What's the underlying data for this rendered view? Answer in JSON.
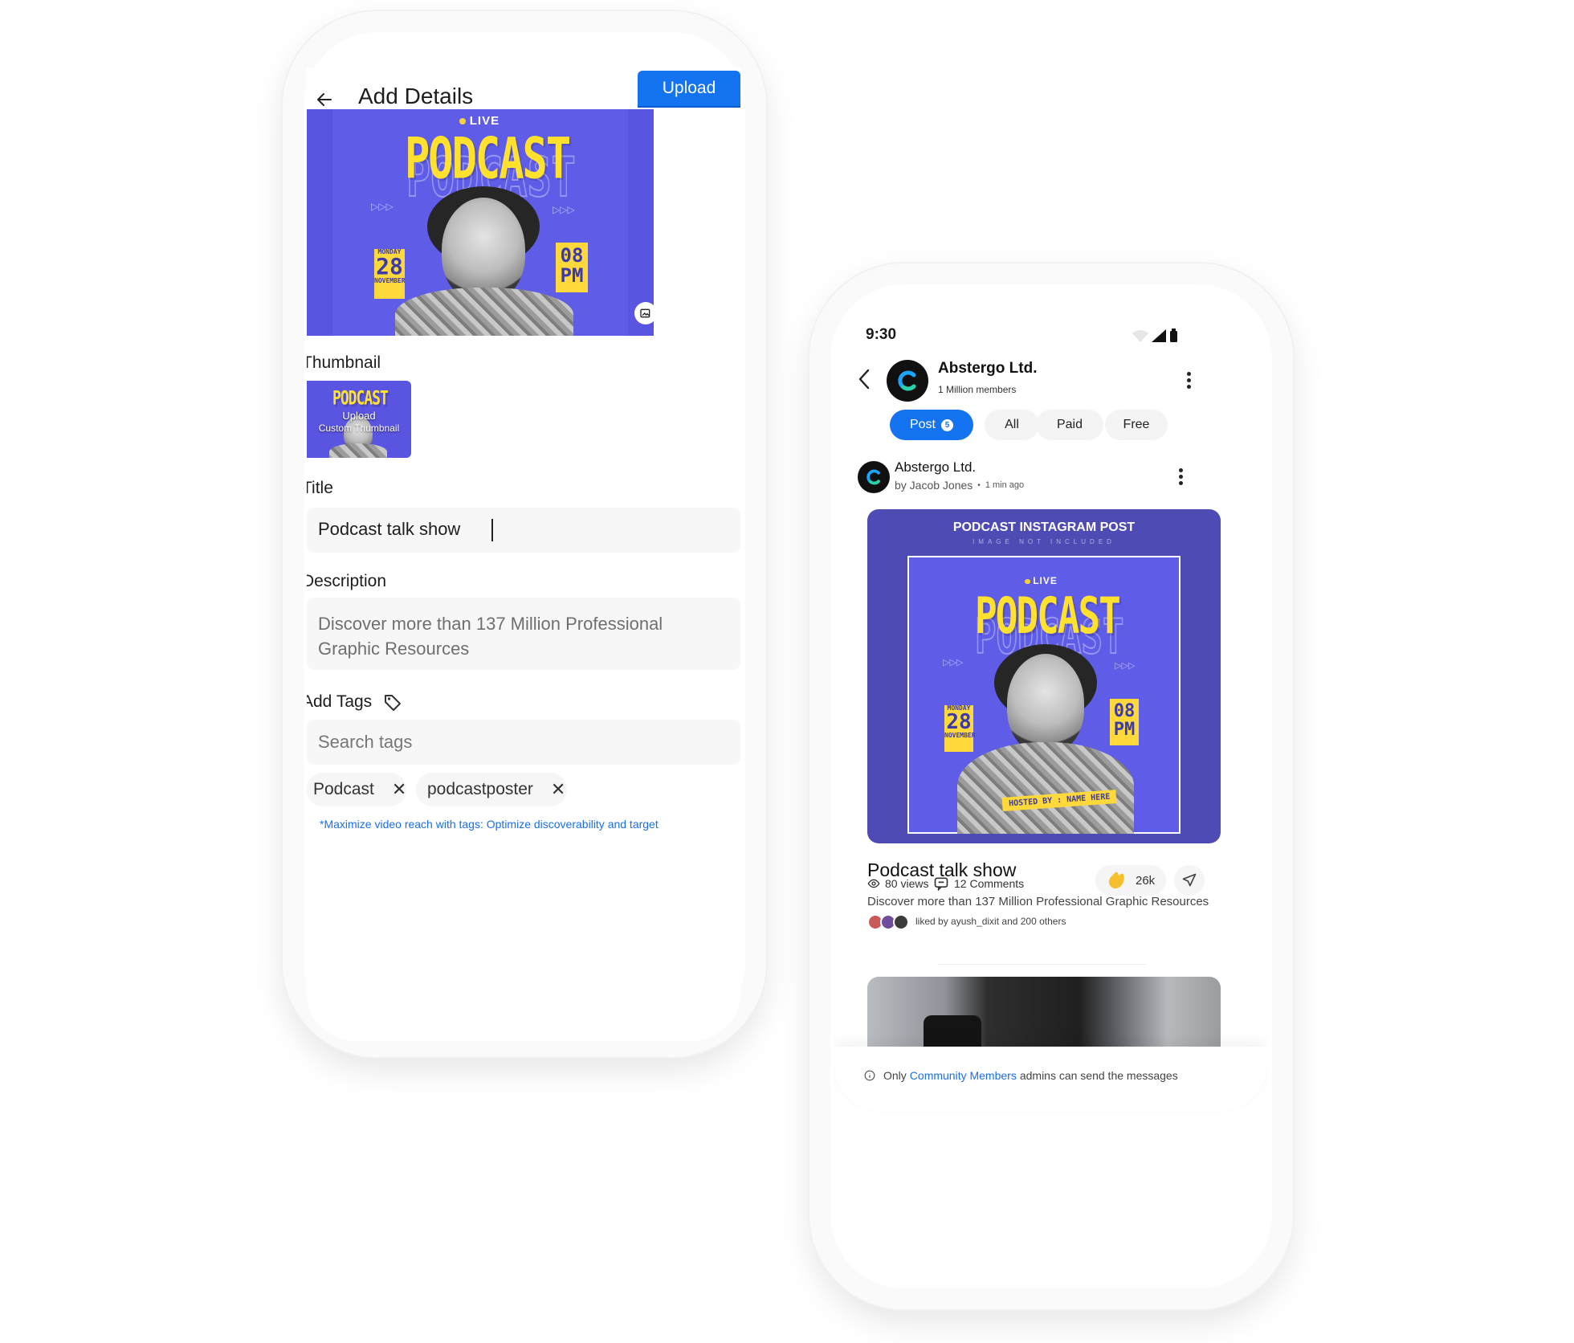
{
  "left": {
    "header": {
      "title": "Add Details",
      "upload_label": "Upload"
    },
    "poster": {
      "live": "LIVE",
      "title": "PODCAST",
      "day": "MONDAY",
      "date": "28",
      "month": "NOVEMBER",
      "time_top": "08",
      "time_unit": "PM"
    },
    "thumbnail": {
      "label": "Thumbnail",
      "upload_text": "Upload",
      "custom_text": "Custom Thumbnail",
      "poster_title": "PODCAST"
    },
    "title_field": {
      "label": "Title",
      "value": "Podcast talk show"
    },
    "description_field": {
      "label": "Description",
      "value": "Discover more than 137 Million Professional Graphic Resources"
    },
    "tags": {
      "label": "Add Tags",
      "search_placeholder": "Search tags",
      "chips": [
        "Podcast",
        "podcastposter"
      ]
    },
    "hint": "*Maximize video reach with tags: Optimize discoverability and target"
  },
  "right": {
    "status": {
      "time": "9:30"
    },
    "community": {
      "name": "Abstergo Ltd.",
      "members": "1 Million members"
    },
    "filters": [
      {
        "label": "Post",
        "badge": "5",
        "active": true
      },
      {
        "label": "All",
        "active": false
      },
      {
        "label": "Paid",
        "active": false
      },
      {
        "label": "Free",
        "active": false
      }
    ],
    "post": {
      "author": "Abstergo Ltd.",
      "by": "by Jacob Jones",
      "time": "1 min ago",
      "image_header": "PODCAST INSTAGRAM POST",
      "image_sub": "IMAGE NOT INCLUDED",
      "poster": {
        "live": "LIVE",
        "title": "PODCAST",
        "day": "MONDAY",
        "date": "28",
        "month": "NOVEMBER",
        "time_top": "08",
        "time_unit": "PM",
        "hosted": "HOSTED BY : NAME HERE"
      },
      "title": "Podcast talk show",
      "description": "Discover more than 137 Million Professional Graphic Resources",
      "views": "80 views",
      "comments": "12 Comments",
      "likes": "26k",
      "liked_by": "liked by ayush_dixit and 200 others"
    },
    "footer": {
      "prefix": "Only",
      "link": "Community Members",
      "suffix": "admins can send the messages"
    }
  },
  "colors": {
    "accent": "#1473f1",
    "poster_bg": "#5a55e0",
    "poster_yellow": "#ffe12e"
  }
}
